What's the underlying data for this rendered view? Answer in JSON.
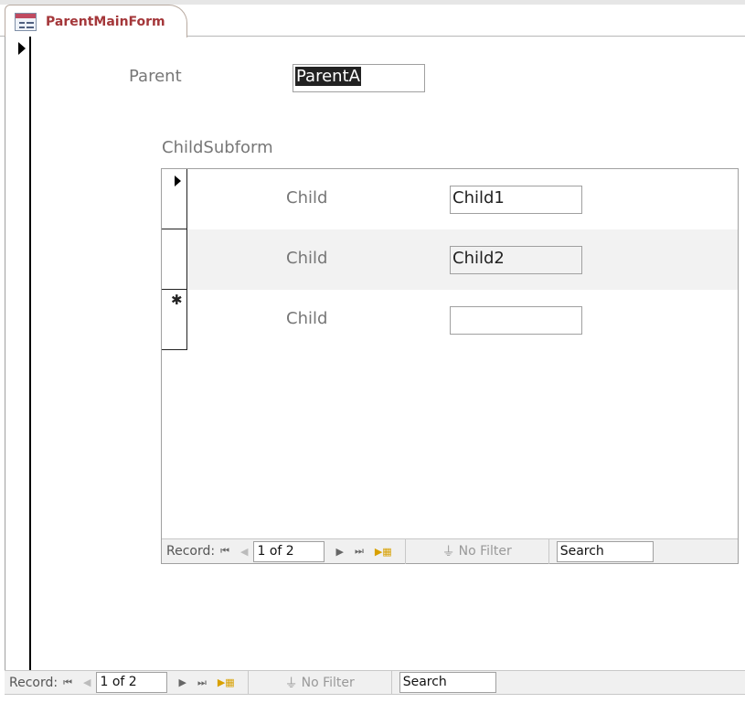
{
  "tab": {
    "title": "ParentMainForm",
    "icon": "form-icon"
  },
  "main": {
    "parent_label": "Parent",
    "parent_value": "ParentA",
    "subform_label": "ChildSubform"
  },
  "subform": {
    "rows": [
      {
        "label": "Child",
        "value": "Child1",
        "selector": "current"
      },
      {
        "label": "Child",
        "value": "Child2",
        "selector": ""
      },
      {
        "label": "Child",
        "value": "",
        "selector": "new"
      }
    ],
    "nav": {
      "record_label": "Record:",
      "position": "1 of 2",
      "filter": "No Filter",
      "search": "Search"
    }
  },
  "main_nav": {
    "record_label": "Record:",
    "position": "1 of 2",
    "filter": "No Filter",
    "search": "Search"
  }
}
